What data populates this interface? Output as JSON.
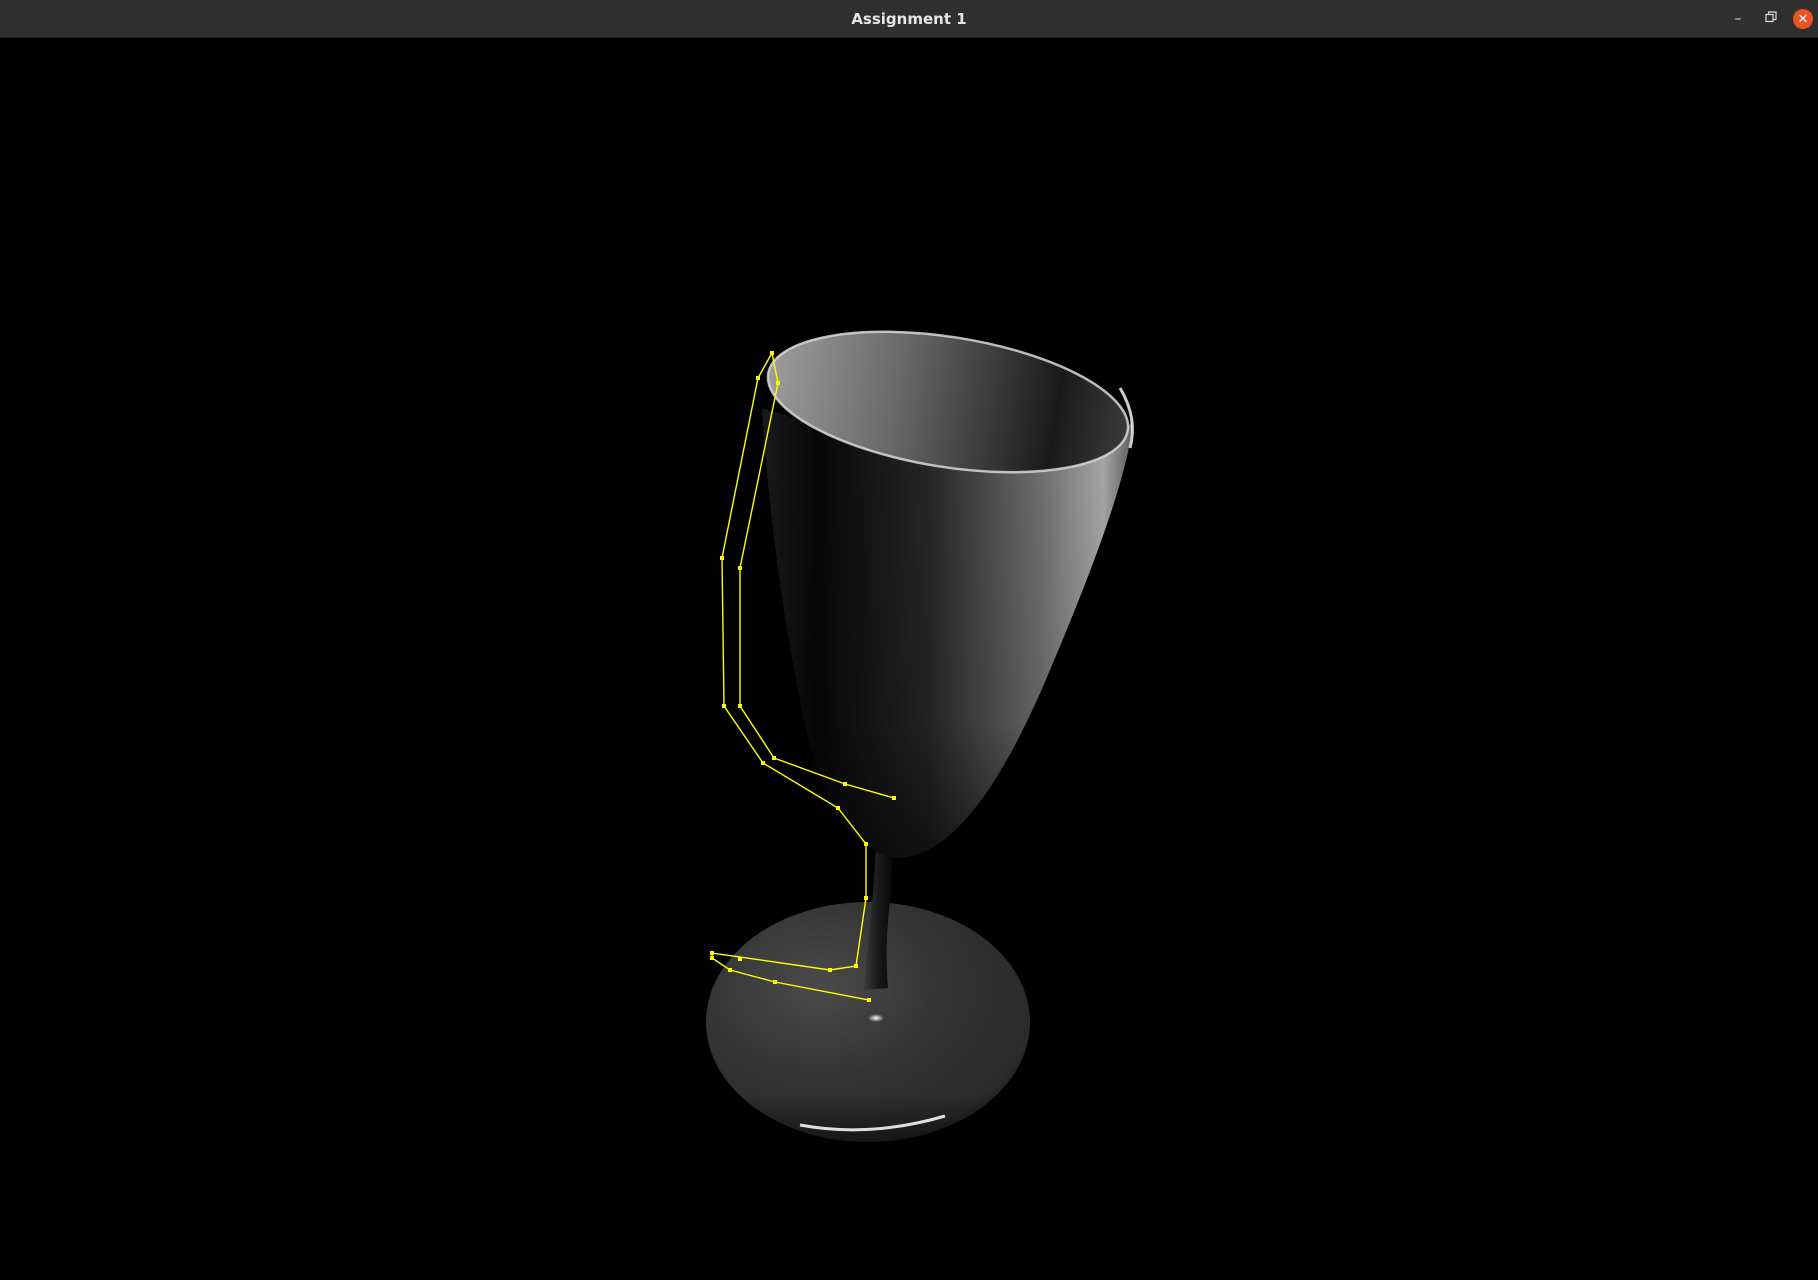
{
  "window": {
    "title": "Assignment 1",
    "controls": {
      "minimize_icon": "minimize-icon",
      "maximize_icon": "restore-icon",
      "close_icon": "close-icon"
    },
    "accent_color": "#e95420"
  },
  "viewport": {
    "background_color": "#000000",
    "object": "goblet-surface-of-revolution",
    "profile_curve_color": "#ffff00"
  }
}
